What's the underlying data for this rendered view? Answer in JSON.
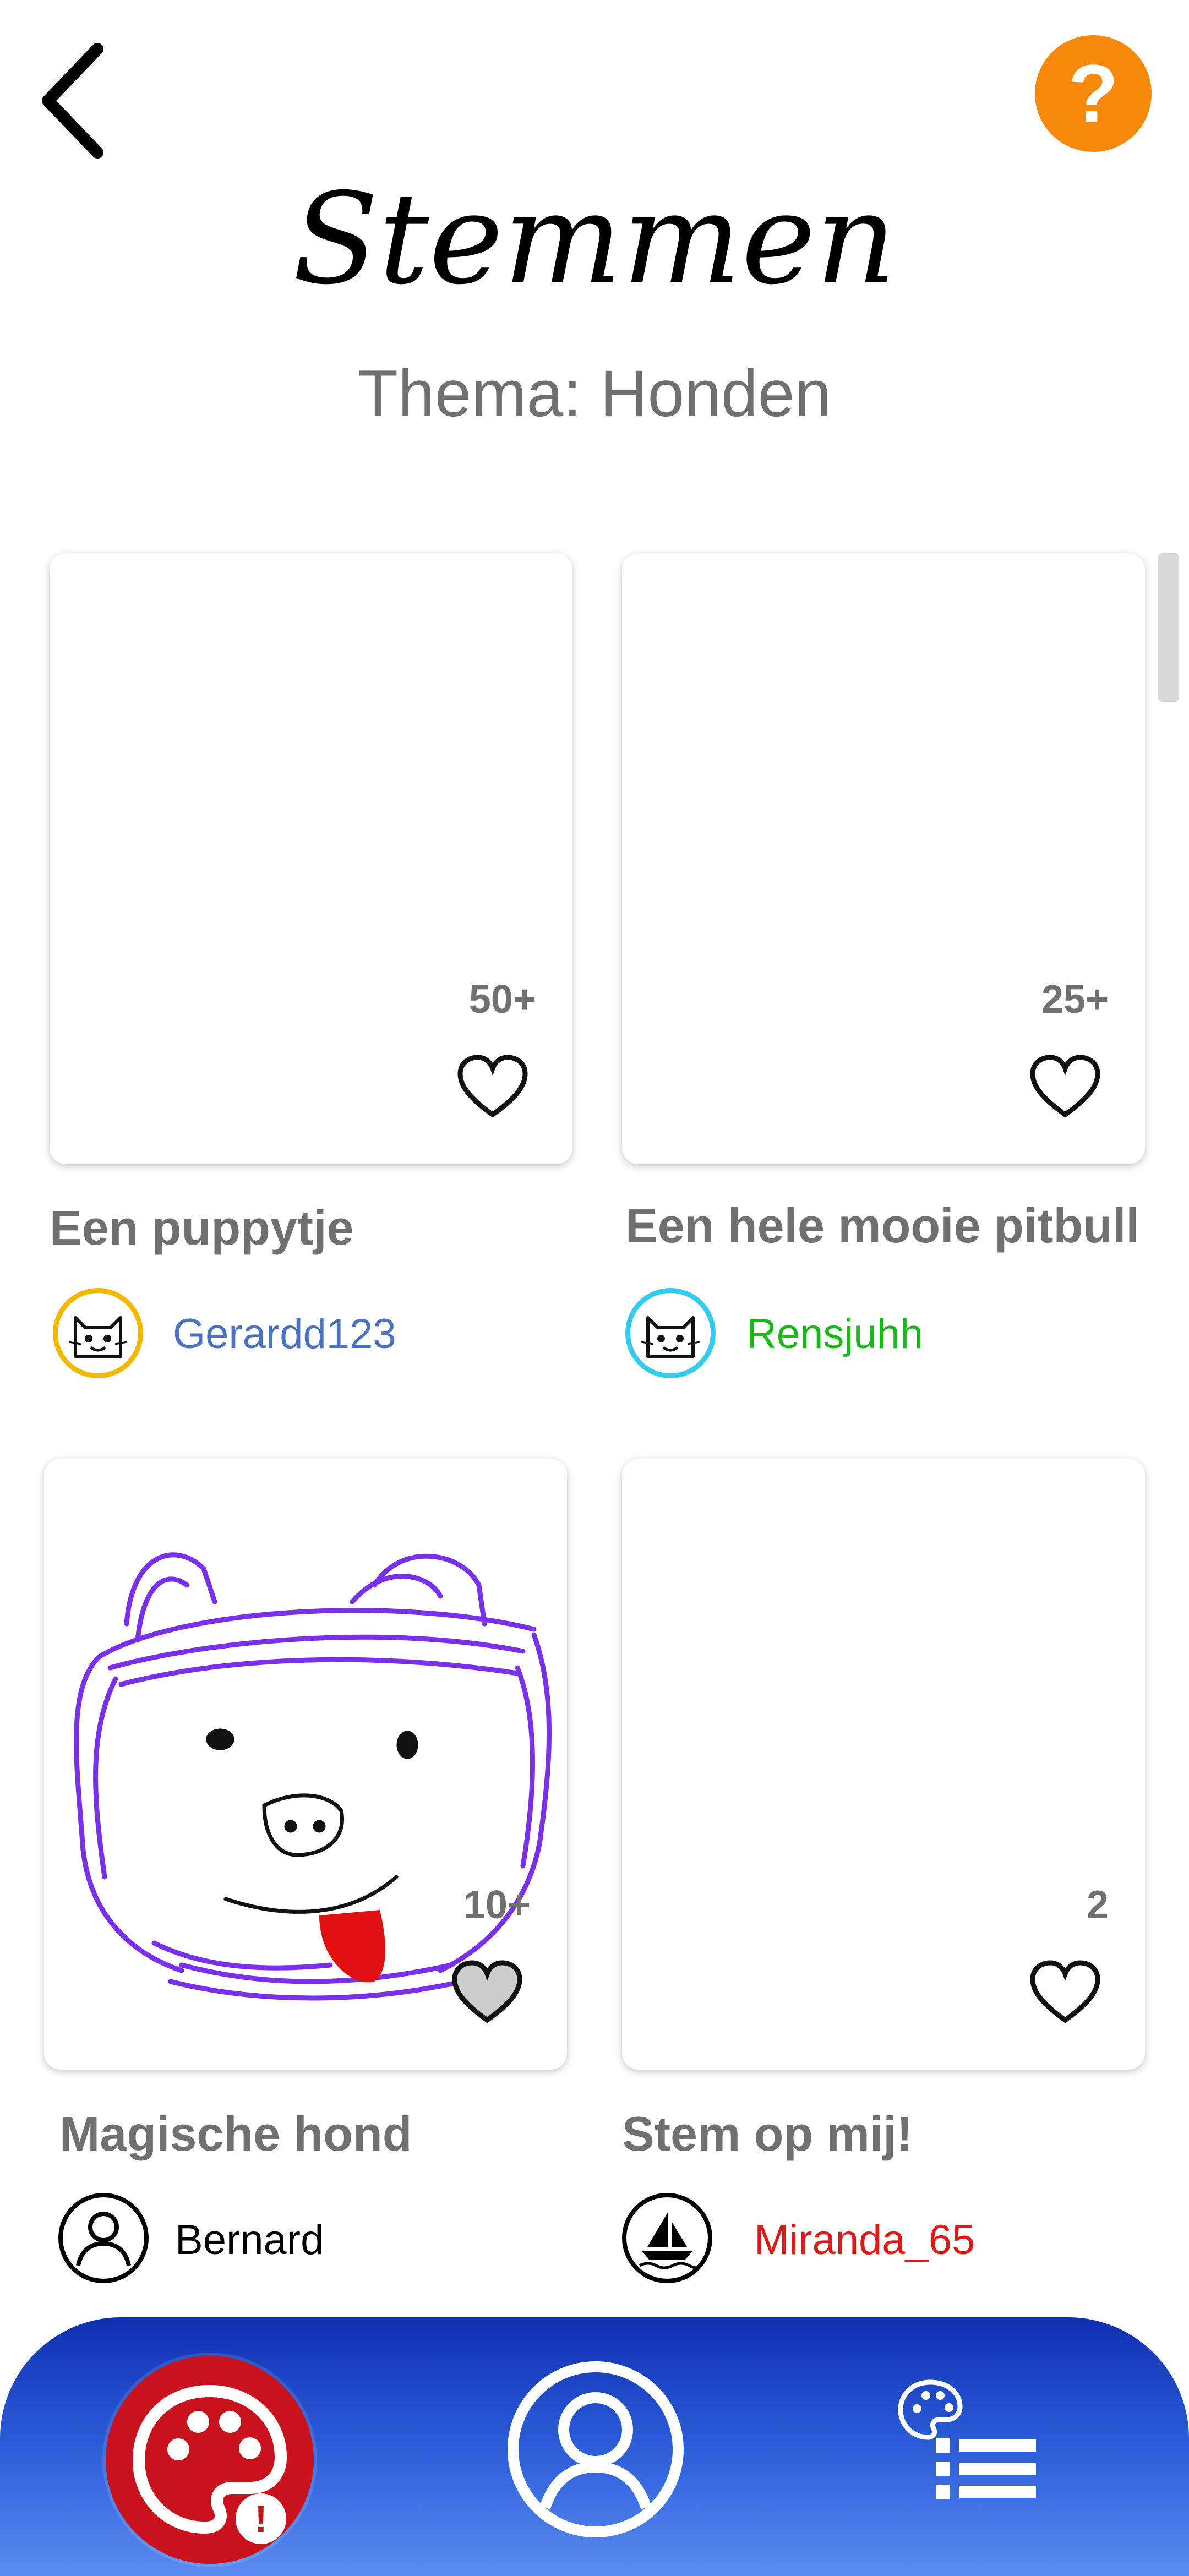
{
  "header": {
    "title": "Stemmen",
    "subtitle": "Thema: Honden",
    "back_icon": "chevron-left-icon",
    "help_label": "?"
  },
  "colors": {
    "help_accent": "#f7890a",
    "nav_bar": "#1f45c6",
    "nav_draw_button": "#c8121c",
    "text_muted": "#707070"
  },
  "entries": [
    {
      "title": "Een puppytje",
      "votes": "50+",
      "author": "Gerardd123",
      "author_color": "#4a72c0",
      "avatar": "cat-avatar-icon",
      "avatar_ring": "#f3b800",
      "liked": false
    },
    {
      "title": "Een hele mooie pitbull",
      "votes": "25+",
      "author": "Rensjuhh",
      "author_color": "#18b818",
      "avatar": "cat-avatar-icon",
      "avatar_ring": "#33ccee",
      "liked": false
    },
    {
      "title": "Magische hond",
      "votes": "10+",
      "author": "Bernard",
      "author_color": "#000000",
      "avatar": "user-avatar-icon",
      "avatar_ring": "#000000",
      "liked": true
    },
    {
      "title": "Stem op mij!",
      "votes": "2",
      "author": "Miranda_65",
      "author_color": "#e01818",
      "avatar": "sailboat-avatar-icon",
      "avatar_ring": "#000000",
      "liked": false
    }
  ],
  "bottom_nav": {
    "items": [
      "palette-icon",
      "profile-icon",
      "palette-list-icon"
    ],
    "draw_alert": "!"
  }
}
